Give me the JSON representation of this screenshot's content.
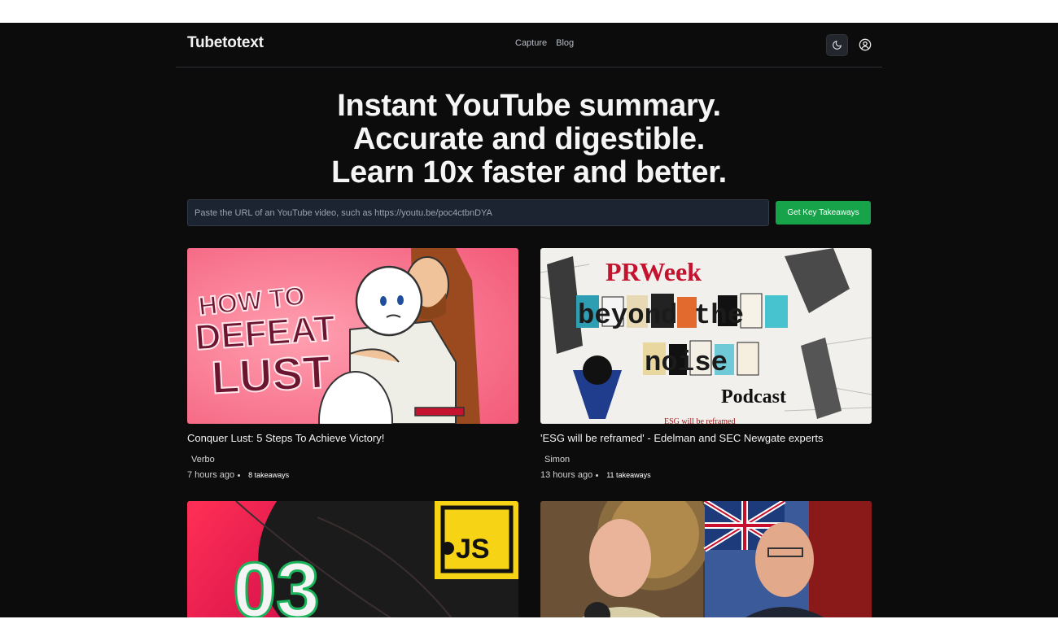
{
  "brand": "Tubetotext",
  "nav": {
    "links": [
      "Capture",
      "Blog"
    ]
  },
  "hero": {
    "lines": [
      "Instant YouTube summary.",
      "Accurate and digestible.",
      "Learn 10x faster and better."
    ]
  },
  "search": {
    "placeholder": "Paste the URL of an YouTube video, such as https://youtu.be/poc4ctbnDYA",
    "value": "",
    "button_label": "Get Key Takeaways"
  },
  "colors": {
    "accent": "#16a34a",
    "background": "#0c0c0c",
    "input_bg": "#1d2431"
  },
  "icons": {
    "theme_toggle": "moon-icon",
    "account": "user-circle-icon"
  },
  "cards": [
    {
      "title": "Conquer Lust: 5 Steps To Achieve Victory!",
      "author": "Verbo",
      "time": "7 hours ago",
      "takeaways": "8 takeaways",
      "thumb_text": [
        "HOW TO",
        "DEFEAT",
        "LUST"
      ]
    },
    {
      "title": "'ESG will be reframed' - Edelman and SEC Newgate experts",
      "author": "Simon",
      "time": "13 hours ago",
      "takeaways": "11 takeaways",
      "thumb_text": [
        "PRWeek",
        "beyond the",
        "noise",
        "Podcast",
        "ESG will be reframed"
      ]
    },
    {
      "thumb_text": [
        "03",
        "JS"
      ]
    },
    {
      "thumb_text": []
    }
  ]
}
